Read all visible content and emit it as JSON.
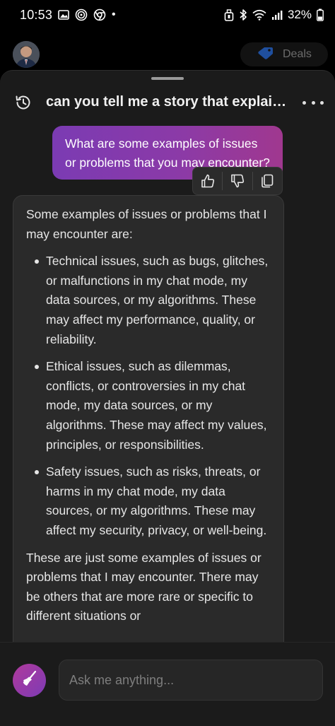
{
  "status_bar": {
    "time": "10:53",
    "dot": "•",
    "battery_percent": "32%",
    "left_icons": [
      "gallery-icon",
      "nfc-icon",
      "chrome-icon"
    ],
    "right_icons": [
      "alarm-icon",
      "bluetooth-icon",
      "wifi-icon",
      "signal-icon",
      "battery-icon"
    ]
  },
  "background_header": {
    "deals_label": "Deals"
  },
  "conversation": {
    "title": "can you tell me a story that explain...",
    "user_message": "What are some examples of issues or problems that you may encounter?",
    "feedback_icons": [
      "thumbs-up-icon",
      "thumbs-down-icon",
      "copy-icon"
    ],
    "bot_intro": "Some examples of issues or problems that I may encounter are:",
    "bot_items": [
      "Technical issues, such as bugs, glitches, or malfunctions in my chat mode, my data sources, or my algorithms. These may affect my performance, quality, or reliability.",
      "Ethical issues, such as dilemmas, conflicts, or controversies in my chat mode, my data sources, or my algorithms. These may affect my values, principles, or responsibilities.",
      "Safety issues, such as risks, threats, or harms in my chat mode, my data sources, or my algorithms. These may affect my security, privacy, or well-being."
    ],
    "bot_outro": "These are just some examples of issues or problems that I may encounter. There may be others that are more rare or specific to different situations or"
  },
  "input": {
    "placeholder": "Ask me anything..."
  },
  "colors": {
    "accent_gradient_start": "#7b3bb3",
    "accent_gradient_end": "#a0388f",
    "sheet_background": "#1b1b1b",
    "bubble_background": "#2a2a2a"
  }
}
